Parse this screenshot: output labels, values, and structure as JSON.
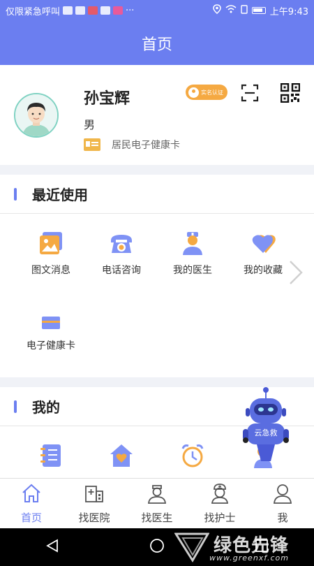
{
  "status_bar": {
    "left_text": "仅限紧急呼叫",
    "dots": "···",
    "time": "上午9:43"
  },
  "header": {
    "title": "首页"
  },
  "profile": {
    "name": "孙宝辉",
    "gender": "男",
    "verify_badge": "实名认证",
    "card_label": "居民电子健康卡"
  },
  "recent": {
    "title": "最近使用",
    "items": [
      {
        "label": "图文消息",
        "icon": "image-message-icon"
      },
      {
        "label": "电话咨询",
        "icon": "phone-icon"
      },
      {
        "label": "我的医生",
        "icon": "doctor-icon"
      },
      {
        "label": "我的收藏",
        "icon": "heart-icon"
      },
      {
        "label": "电子健康卡",
        "icon": "health-card-icon"
      }
    ]
  },
  "mine": {
    "title": "我的",
    "items": [
      {
        "icon": "notebook-icon"
      },
      {
        "icon": "home-heart-icon"
      },
      {
        "icon": "alarm-clock-icon"
      },
      {
        "icon": "nurse-icon"
      }
    ]
  },
  "robot": {
    "label": "云急救"
  },
  "tabs": [
    {
      "label": "首页",
      "icon": "home-icon",
      "active": true
    },
    {
      "label": "找医院",
      "icon": "hospital-icon",
      "active": false
    },
    {
      "label": "找医生",
      "icon": "doctor-tab-icon",
      "active": false
    },
    {
      "label": "找护士",
      "icon": "nurse-tab-icon",
      "active": false
    },
    {
      "label": "我",
      "icon": "person-icon",
      "active": false
    }
  ],
  "watermark": {
    "text": "绿色先锋",
    "url": "www.greenxf.com"
  },
  "colors": {
    "primary": "#6b7ef0",
    "accent_orange": "#f5a942",
    "avatar_ring": "#7fd2c2"
  }
}
